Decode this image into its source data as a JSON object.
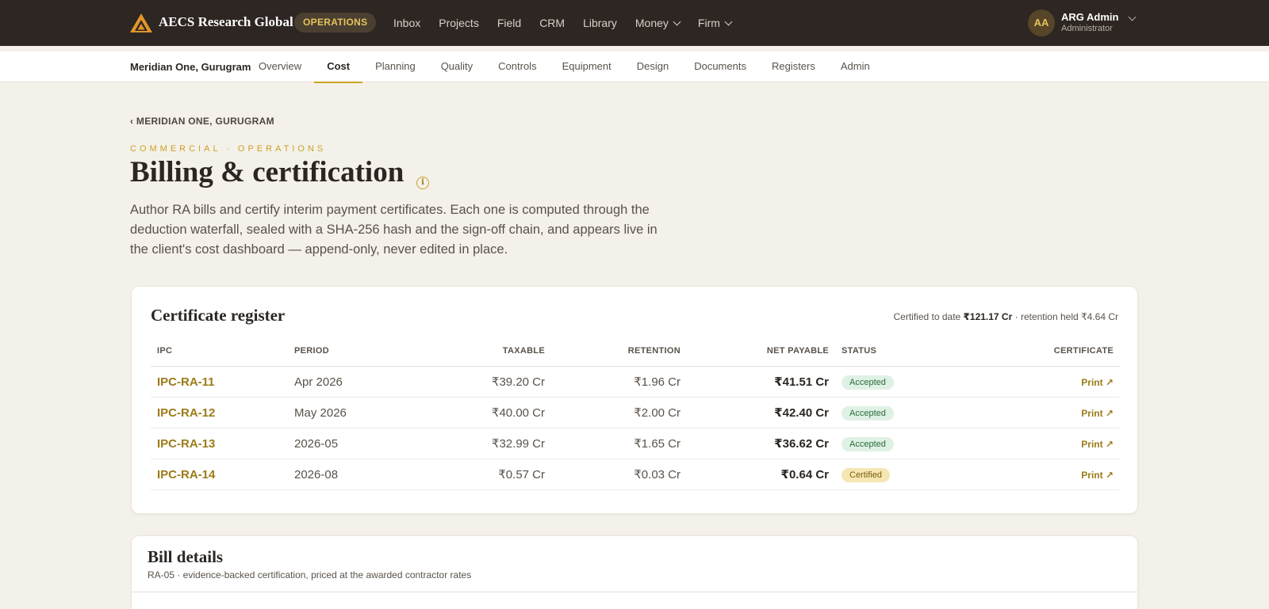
{
  "app": {
    "brand": "AECS Research Global",
    "mode_badge": "OPERATIONS",
    "logo_icon": "triangle-logo-icon",
    "accent_color": "#c9a227"
  },
  "nav": {
    "items": [
      {
        "label": "Inbox"
      },
      {
        "label": "Projects"
      },
      {
        "label": "Field"
      },
      {
        "label": "CRM"
      },
      {
        "label": "Library"
      },
      {
        "label": "Money",
        "dropdown": true
      },
      {
        "label": "Firm",
        "dropdown": true
      }
    ]
  },
  "user": {
    "initials": "AA",
    "name": "ARG Admin",
    "role": "Administrator"
  },
  "subnav": {
    "project": "Meridian One, Gurugram",
    "tabs": [
      {
        "label": "Overview"
      },
      {
        "label": "Cost",
        "active": true
      },
      {
        "label": "Planning"
      },
      {
        "label": "Quality"
      },
      {
        "label": "Controls"
      },
      {
        "label": "Equipment"
      },
      {
        "label": "Design"
      },
      {
        "label": "Documents"
      },
      {
        "label": "Registers"
      },
      {
        "label": "Admin"
      }
    ]
  },
  "header": {
    "breadcrumb": "‹ MERIDIAN ONE, GURUGRAM",
    "eyebrow": "COMMERCIAL · OPERATIONS",
    "title": "Billing & certification",
    "intro": "Author RA bills and certify interim payment certificates. Each one is computed through the deduction waterfall, sealed with a SHA-256 hash and the sign-off chain, and appears live in the client's cost dashboard — append-only, never edited in place."
  },
  "register": {
    "title": "Certificate register",
    "summary_prefix": "Certified to date ",
    "certified_total": "₹121.17 Cr",
    "summary_mid": " · retention held ",
    "retention_held": "₹4.64 Cr",
    "columns": {
      "ipc": "IPC",
      "period": "PERIOD",
      "taxable": "TAXABLE",
      "retention": "RETENTION",
      "net": "NET PAYABLE",
      "status": "STATUS",
      "certificate": "CERTIFICATE"
    },
    "rows": [
      {
        "ipc": "IPC-RA-11",
        "period": "Apr 2026",
        "taxable": "₹39.20 Cr",
        "retention": "₹1.96 Cr",
        "net": "₹41.51 Cr",
        "status": "Accepted",
        "action": "Print ↗"
      },
      {
        "ipc": "IPC-RA-12",
        "period": "May 2026",
        "taxable": "₹40.00 Cr",
        "retention": "₹2.00 Cr",
        "net": "₹42.40 Cr",
        "status": "Accepted",
        "action": "Print ↗"
      },
      {
        "ipc": "IPC-RA-13",
        "period": "2026-05",
        "taxable": "₹32.99 Cr",
        "retention": "₹1.65 Cr",
        "net": "₹36.62 Cr",
        "status": "Accepted",
        "action": "Print ↗"
      },
      {
        "ipc": "IPC-RA-14",
        "period": "2026-08",
        "taxable": "₹0.57 Cr",
        "retention": "₹0.03 Cr",
        "net": "₹0.64 Cr",
        "status": "Certified",
        "action": "Print ↗"
      }
    ]
  },
  "bill_details": {
    "title": "Bill details",
    "subtitle": "RA-05 · evidence-backed certification, priced at the awarded contractor rates"
  }
}
